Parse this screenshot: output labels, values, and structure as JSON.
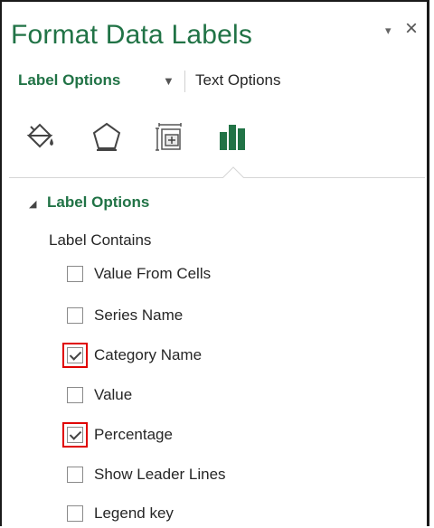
{
  "pane": {
    "title": "Format Data Labels",
    "dropdown_glyph": "▾",
    "close_glyph": "×"
  },
  "tabs": [
    {
      "label": "Label Options",
      "active": true
    },
    {
      "label": "Text Options",
      "active": false
    }
  ],
  "tab_dropdown_glyph": "▼",
  "icons": [
    {
      "name": "fill-line-icon",
      "selected": false
    },
    {
      "name": "effects-icon",
      "selected": false
    },
    {
      "name": "size-properties-icon",
      "selected": false
    },
    {
      "name": "label-options-icon",
      "selected": true
    }
  ],
  "section": {
    "toggle_glyph": "◢",
    "title": "Label Options",
    "contains_label": "Label Contains"
  },
  "options": [
    {
      "key": "V",
      "label": "Value From Cells",
      "checked": false,
      "highlighted": false
    },
    {
      "key": "S",
      "label": "Series Name",
      "checked": false,
      "highlighted": false
    },
    {
      "key": "g",
      "label": "Category Name",
      "checked": true,
      "highlighted": true
    },
    {
      "key": "V",
      "label": "Value",
      "checked": false,
      "highlighted": false
    },
    {
      "key": "P",
      "label": "Percentage",
      "checked": true,
      "highlighted": true
    },
    {
      "key": "h",
      "label": "Show Leader Lines",
      "checked": false,
      "highlighted": false
    },
    {
      "key": "L",
      "label": "Legend key",
      "checked": false,
      "highlighted": false
    }
  ],
  "colors": {
    "accent": "#217346",
    "highlight": "#e00000"
  }
}
